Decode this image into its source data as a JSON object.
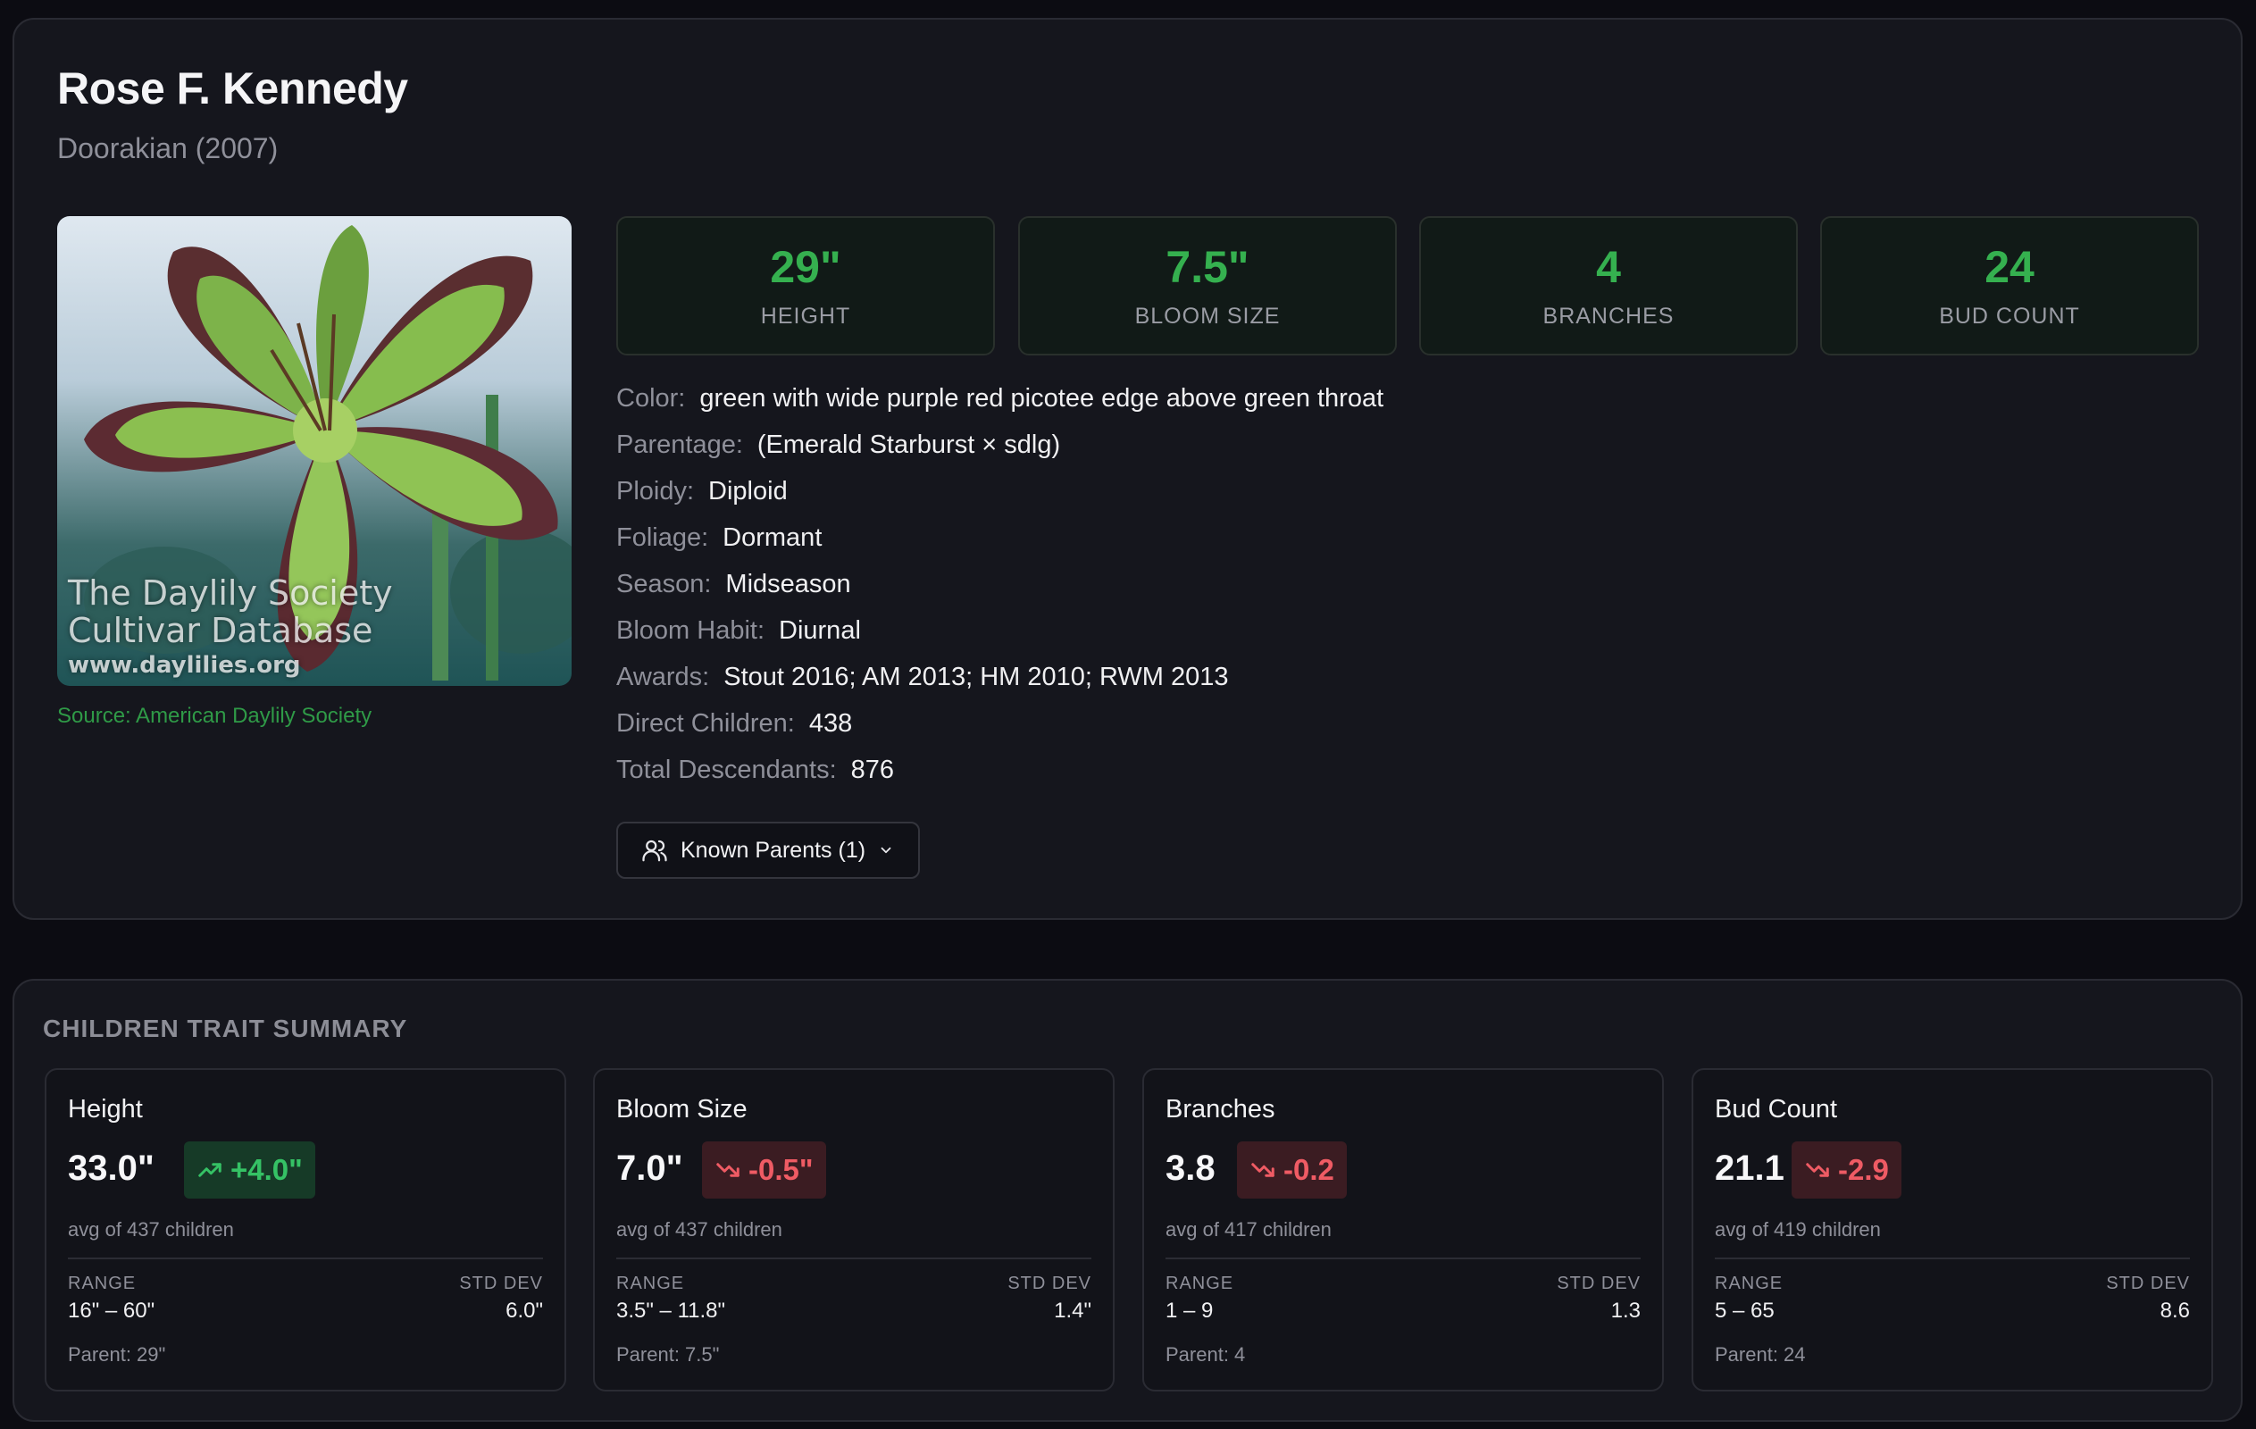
{
  "cultivar": {
    "name": "Rose F. Kennedy",
    "hybridizer_year": "Doorakian (2007)"
  },
  "image": {
    "watermark_line1": "The Daylily Society",
    "watermark_line2": "Cultivar Database",
    "watermark_url": "www.daylilies.org",
    "source": "Source: American Daylily Society"
  },
  "stats": [
    {
      "value": "29\"",
      "label": "HEIGHT"
    },
    {
      "value": "7.5\"",
      "label": "BLOOM SIZE"
    },
    {
      "value": "4",
      "label": "BRANCHES"
    },
    {
      "value": "24",
      "label": "BUD COUNT"
    }
  ],
  "details": [
    {
      "key": "Color:",
      "value": "green with wide purple red picotee edge above green throat"
    },
    {
      "key": "Parentage:",
      "value": "(Emerald Starburst × sdlg)"
    },
    {
      "key": "Ploidy:",
      "value": "Diploid"
    },
    {
      "key": "Foliage:",
      "value": "Dormant"
    },
    {
      "key": "Season:",
      "value": "Midseason"
    },
    {
      "key": "Bloom Habit:",
      "value": "Diurnal"
    },
    {
      "key": "Awards:",
      "value": "Stout 2016; AM 2013; HM 2010; RWM 2013"
    },
    {
      "key": "Direct Children:",
      "value": "438"
    },
    {
      "key": "Total Descendants:",
      "value": "876"
    }
  ],
  "parents_button": {
    "label": "Known Parents (1)",
    "icon": "users-icon"
  },
  "summary": {
    "title": "CHILDREN TRAIT SUMMARY",
    "range_label": "RANGE",
    "std_label": "STD DEV",
    "traits": [
      {
        "name": "Height",
        "avg": "33.0\"",
        "delta": "+4.0\"",
        "direction": "up",
        "note": "avg of 437 children",
        "range": "16\" – 60\"",
        "std": "6.0\"",
        "parent": "Parent: 29\""
      },
      {
        "name": "Bloom Size",
        "avg": "7.0\"",
        "delta": "-0.5\"",
        "direction": "down",
        "note": "avg of 437 children",
        "range": "3.5\" – 11.8\"",
        "std": "1.4\"",
        "parent": "Parent: 7.5\""
      },
      {
        "name": "Branches",
        "avg": "3.8",
        "delta": "-0.2",
        "direction": "down",
        "note": "avg of 417 children",
        "range": "1 – 9",
        "std": "1.3",
        "parent": "Parent: 4"
      },
      {
        "name": "Bud Count",
        "avg": "21.1",
        "delta": "-2.9",
        "direction": "down",
        "note": "avg of 419 children",
        "range": "5 – 65",
        "std": "8.6",
        "parent": "Parent: 24"
      }
    ]
  },
  "colors": {
    "accent_green": "#35b04f",
    "positive": "#35c265",
    "negative": "#ef5b64",
    "background": "#0c0c12",
    "card": "#15161d"
  }
}
